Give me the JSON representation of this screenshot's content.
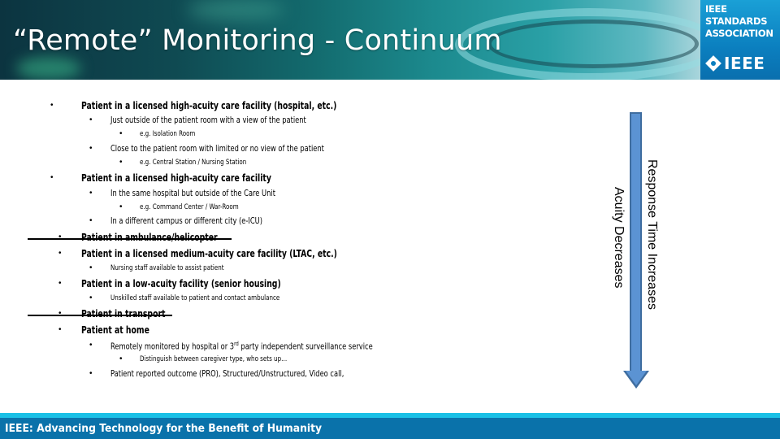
{
  "header": {
    "title": "“Remote” Monitoring - Continuum",
    "logo": {
      "line1": "IEEE",
      "line2": "STANDARDS",
      "line3": "ASSOCIATION",
      "wordmark": "IEEE",
      "icon": "ieee-diamond-icon"
    }
  },
  "bullets": [
    {
      "level": 1,
      "text": "Patient in a licensed high-acuity care facility (hospital, etc.)",
      "struck": false
    },
    {
      "level": 2,
      "text": "Just outside of the patient room with a view of the patient",
      "struck": false
    },
    {
      "level": 3,
      "text": "e.g. Isolation Room",
      "struck": false
    },
    {
      "level": 2,
      "text": "Close to the patient room with limited or no view of the patient",
      "struck": false
    },
    {
      "level": 3,
      "text": "e.g. Central Station / Nursing Station",
      "struck": false
    },
    {
      "level": 1,
      "text": "Patient in a licensed high-acuity care facility",
      "struck": false
    },
    {
      "level": 2,
      "text": "In the same hospital but outside of the Care Unit",
      "struck": false
    },
    {
      "level": 3,
      "text": "e.g. Command Center / War-Room",
      "struck": false
    },
    {
      "level": 2,
      "text": "In a different campus or different city (e-ICU)",
      "struck": false
    },
    {
      "level": 1,
      "text": "Patient in ambulance/helicopter",
      "struck": true
    },
    {
      "level": 1,
      "text": "Patient in a licensed medium-acuity care facility (LTAC, etc.)",
      "struck": false
    },
    {
      "level": 2,
      "text": "Nursing staff available to assist patient",
      "struck": false
    },
    {
      "level": 1,
      "text": "Patient in a low-acuity facility (senior housing)",
      "struck": false
    },
    {
      "level": 2,
      "text": "Unskilled staff available to  patient and contact ambulance",
      "struck": false
    },
    {
      "level": 1,
      "text": "Patient in transport",
      "struck": true
    },
    {
      "level": 1,
      "text": "Patient at home",
      "struck": false
    },
    {
      "level": 2,
      "text_before": "Remotely monitored by hospital or 3",
      "sup": "rd",
      "text_after": " party independent surveillance service",
      "struck": false
    },
    {
      "level": 3,
      "text": "Distinguish between caregiver type, who sets up…",
      "struck": false
    },
    {
      "level": 2,
      "text": "Patient reported outcome (PRO), Structured/Unstructured, Video call,",
      "struck": false
    }
  ],
  "bullet_glyph": "•",
  "arrow": {
    "direction": "down",
    "label_outer": "Response Time Increases",
    "label_inner": "Acuity Decreases",
    "color": "#5b93d3"
  },
  "footer": {
    "text": "IEEE: Advancing Technology for the Benefit of Humanity"
  },
  "colors": {
    "footer_bg": "#0a72aa",
    "footer_stripe": "#19c0e6",
    "logo_bg": "#0b7fbf"
  }
}
